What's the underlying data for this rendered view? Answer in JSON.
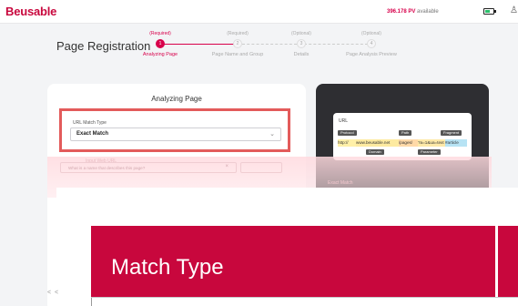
{
  "header": {
    "logo": "Beusable",
    "pv_amount": "396.178 PV",
    "pv_suffix": "available"
  },
  "page_title": "Page Registration",
  "steps": [
    {
      "tag": "(Required)",
      "num": "1",
      "label": "Analyzing Page",
      "active": true
    },
    {
      "tag": "(Required)",
      "num": "2",
      "label": "Page Name and Group",
      "active": false
    },
    {
      "tag": "(Optional)",
      "num": "3",
      "label": "Details",
      "active": false
    },
    {
      "tag": "(Optional)",
      "num": "4",
      "label": "Page Analysis Preview",
      "active": false
    }
  ],
  "card": {
    "title": "Analyzing Page",
    "match_label": "URL Match Type",
    "match_value": "Exact Match",
    "input_placeholder": "What is a name that describes this page?",
    "input_label": "Input Web URL"
  },
  "url_diagram": {
    "title": "URL",
    "chips": {
      "protocol": "Protocol",
      "path": "Path",
      "fragment": "Fragment",
      "domain": "Domain",
      "parameter": "Parameter"
    },
    "segments": {
      "protocol": "http://",
      "domain": "www.beusable.net",
      "path": "/pages/",
      "params": "?a=1&ua=text",
      "fragment": "#article"
    },
    "colors": {
      "protocol": "#fff0a8",
      "domain": "#fdeaa0",
      "path": "#ffd9a8",
      "params": "#fde9a8",
      "fragment": "#b7e3f4"
    }
  },
  "overlay": {
    "right_text": "Exact Match"
  },
  "zoom": {
    "title": "Match Type"
  },
  "pager": "< <",
  "colors": {
    "brand": "#c8073d",
    "accent": "#d8004b",
    "highlight_border": "#e35b5b",
    "dark_panel": "#2e2e32"
  }
}
